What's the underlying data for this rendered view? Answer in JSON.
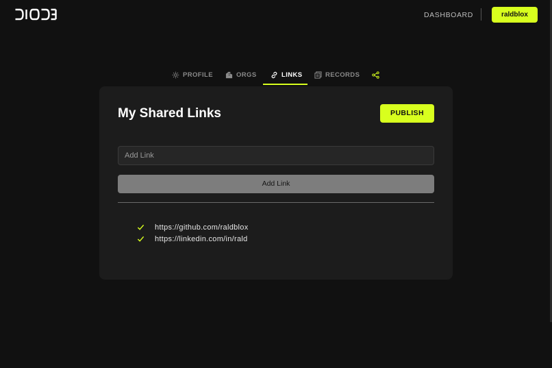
{
  "header": {
    "logo_text": "DIODE",
    "dashboard_label": "DASHBOARD",
    "user_label": "raldblox"
  },
  "tabs": [
    {
      "label": "PROFILE",
      "icon": "gear-icon",
      "active": false
    },
    {
      "label": "ORGS",
      "icon": "building-icon",
      "active": false
    },
    {
      "label": "LINKS",
      "icon": "link-icon",
      "active": true
    },
    {
      "label": "RECORDS",
      "icon": "records-icon",
      "active": false
    },
    {
      "label": "",
      "icon": "share-icon",
      "active": false
    }
  ],
  "card": {
    "title": "My Shared Links",
    "publish_label": "PUBLISH",
    "input_placeholder": "Add Link",
    "add_button_label": "Add Link",
    "links": [
      "https://github.com/raldblox",
      "https://linkedin.com/in/rald"
    ]
  },
  "colors": {
    "accent": "#d8ff1e",
    "background": "#111111",
    "card": "#1c1c1c"
  }
}
